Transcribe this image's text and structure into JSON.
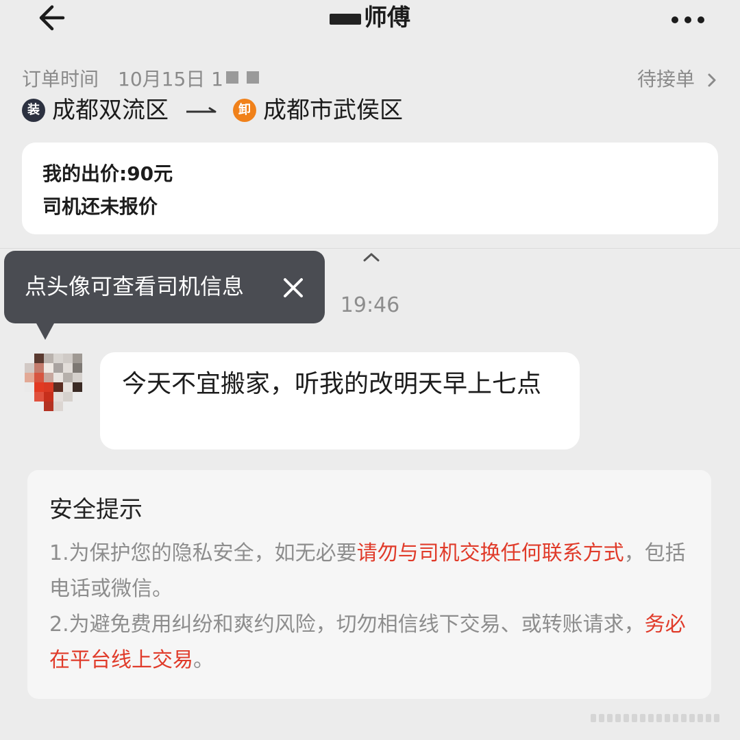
{
  "header": {
    "title": "师傅",
    "back_icon": "back-arrow-icon",
    "more_icon": "more-dots-icon"
  },
  "order": {
    "time_label": "订单时间",
    "time_value": "10月15日 1",
    "status": "待接单",
    "status_chevron": "›",
    "origin_badge": "装",
    "origin": "成都双流区",
    "destination_badge": "卸",
    "destination": "成都市武侯区"
  },
  "price_card": {
    "my_offer": "我的出价:90元",
    "driver_quote": "司机还未报价"
  },
  "tooltip": {
    "text": "点头像可查看司机信息"
  },
  "chat": {
    "timestamp": "19:46",
    "message": "今天不宜搬家，听我的改明天早上七点"
  },
  "safety": {
    "title": "安全提示",
    "item1_prefix": "1.为保护您的隐私安全，如无必要",
    "item1_highlight": "请勿与司机交换任何联系方式",
    "item1_suffix": "，包括电话或微信。",
    "item2_prefix": "2.为避免费用纠纷和爽约风险，切勿相信线下交易、或转账请求，",
    "item2_highlight": "务必在平台线上交易",
    "item2_suffix": "。"
  },
  "colors": {
    "background": "#ececec",
    "card": "#ffffff",
    "tooltip": "#4a4c52",
    "accent_red": "#e03b2a",
    "origin_badge": "#2c3140",
    "destination_badge": "#f0811a",
    "muted_text": "#8a8a8a"
  }
}
